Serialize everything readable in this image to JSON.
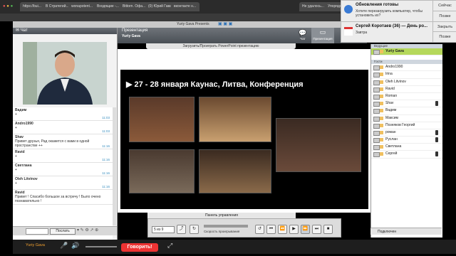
{
  "browser": {
    "tabs": [
      "https://bui...",
      "В Стратегий...",
      "wonapotent...",
      "Входящие -...",
      "Bittorn. Офа...",
      "(0) Юрий Гава",
      "вконтакте н...",
      "Не удалось...",
      "Упорядоч..."
    ],
    "active_tab": "Yuriy Gava Presents"
  },
  "chat": {
    "title": "Чат",
    "messages": [
      {
        "name": "Вадим",
        "text": "+",
        "time": "11:03"
      },
      {
        "name": "Andro1990",
        "text": "+",
        "time": "11:03"
      },
      {
        "name": "Shav",
        "text": "Привет друзья, Рад окажется с вами в одной пространстве ++",
        "time": "11:16"
      },
      {
        "name": "Ravid",
        "text": "+",
        "time": "11:16"
      },
      {
        "name": "Светлана",
        "text": "+",
        "time": "11:16"
      },
      {
        "name": "Oleh Litvinov",
        "text": "+",
        "time": "11:16"
      },
      {
        "name": "Ravid",
        "text": "Привет ! Спасибо большое за встречу ! Было очено познавательно !",
        "time": ""
      }
    ],
    "send_label": "Послать"
  },
  "presentation": {
    "title": "Презентация",
    "presenter": "Yuriy Gava",
    "upload_label": "Загрузить/Проиграть PowerPoint презентацию",
    "slide_title": "▶ 27 - 28 января Каунас, Литва, Конференция",
    "tab_chat": "Чат",
    "tab_presentation": "Презентация",
    "control_panel": "Панель управления",
    "slide_counter": "5 из 9",
    "speed_label": "Скорость проигрывания"
  },
  "participants": {
    "section_presenters": "Ведущие",
    "section_guests": "Гости",
    "presenter": "Yuriy Gava",
    "guests": [
      "Andro1990",
      "Irina",
      "Oleh Litvinov",
      "Ravid",
      "Roman",
      "Shav",
      "Вадим",
      "Максим",
      "Позняков Георгий",
      "роман",
      "Руслан",
      "Светлана",
      "Сергей"
    ],
    "footer": "Подключен"
  },
  "notifications": [
    {
      "title": "Обновления готовы",
      "body": "Хотите перезагрузить компьютер, чтобы установить их?",
      "btn1": "Сейчас",
      "btn2": "Позже"
    },
    {
      "title": "Сергей Коротаев (36) — День ро...",
      "body": "Завтра",
      "btn1": "Закрыть",
      "btn2": "Позже"
    }
  ],
  "bottom": {
    "user": "Yuriy Gava",
    "speak_label": "Говорить!"
  },
  "colors": {
    "speak": "#e33333",
    "highlight": "#b5d85b"
  }
}
